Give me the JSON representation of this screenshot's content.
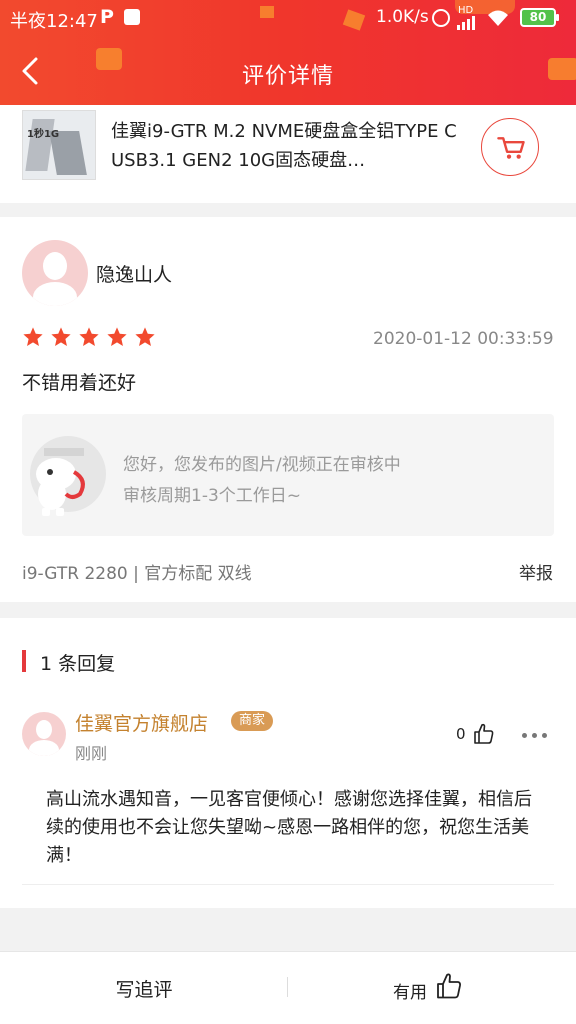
{
  "status_bar": {
    "time": "半夜12:47",
    "app_icon": "P",
    "network_speed": "1.0K/s",
    "hd_label": "HD",
    "battery": "80"
  },
  "header": {
    "title": "评价详情"
  },
  "product": {
    "name": "佳翼i9-GTR M.2 NVME硬盘盒全铝TYPE C USB3.1 GEN2 10G固态硬盘…",
    "image_text": "1秒1G"
  },
  "review": {
    "username": "隐逸山人",
    "rating": 5,
    "date": "2020-01-12 00:33:59",
    "content": "不错用着还好",
    "media_notice_line1": "您好，您发布的图片/视频正在审核中",
    "media_notice_line2": "审核周期1-3个工作日~",
    "spec": "i9-GTR 2280 | 官方标配 双线",
    "report_label": "举报"
  },
  "replies": {
    "header": "1 条回复",
    "items": [
      {
        "author": "佳翼官方旗舰店",
        "tag": "商家",
        "time": "刚刚",
        "likes": "0",
        "content": "高山流水遇知音，一见客官便倾心！感谢您选择佳翼，相信后续的使用也不会让您失望呦~感恩一路相伴的您，祝您生活美满！"
      }
    ]
  },
  "bottom_bar": {
    "follow_up_label": "写追评",
    "useful_label": "有用"
  },
  "colors": {
    "header_red": "#f0362c",
    "accent_red": "#e4393c",
    "merchant_gold": "#c4822f",
    "star_red": "#f24a2e"
  }
}
